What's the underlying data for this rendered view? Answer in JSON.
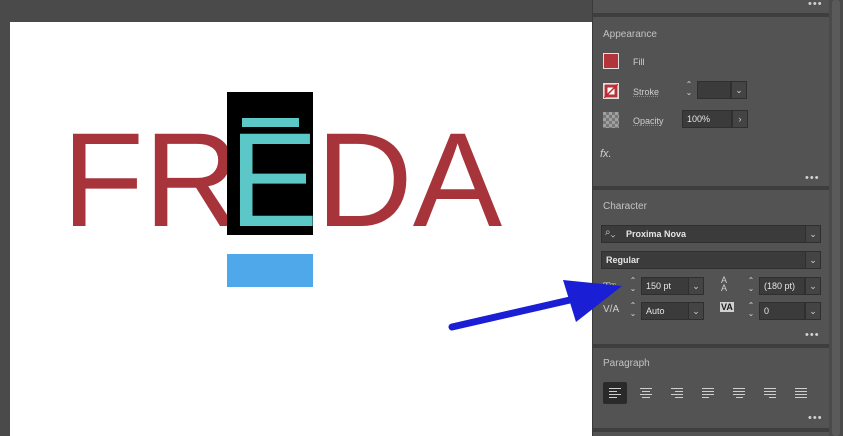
{
  "artwork": {
    "letters_left": "FR",
    "selected_letter": "E",
    "letters_right": "DA",
    "colors": {
      "text": "#a7343b",
      "highlight_bg": "#000000",
      "selected_text": "#5bc7c7",
      "cursor_block": "#4ea8ea"
    }
  },
  "appearance": {
    "title": "Appearance",
    "fill_label": "Fill",
    "stroke_label": "Stroke",
    "opacity_label": "Opacity",
    "opacity_value": "100%",
    "fx_label": "fx.",
    "fill_color": "#b2353c"
  },
  "character": {
    "title": "Character",
    "font_family": "Proxima Nova",
    "font_style": "Regular",
    "font_size": "150 pt",
    "leading": "(180 pt)",
    "kerning": "Auto",
    "tracking": "0"
  },
  "paragraph": {
    "title": "Paragraph",
    "align_buttons": [
      "align-left",
      "align-center",
      "align-right",
      "justify-left",
      "justify-center",
      "justify-right",
      "justify-all"
    ]
  },
  "annotation": {
    "arrow_color": "#1a1fd6"
  }
}
